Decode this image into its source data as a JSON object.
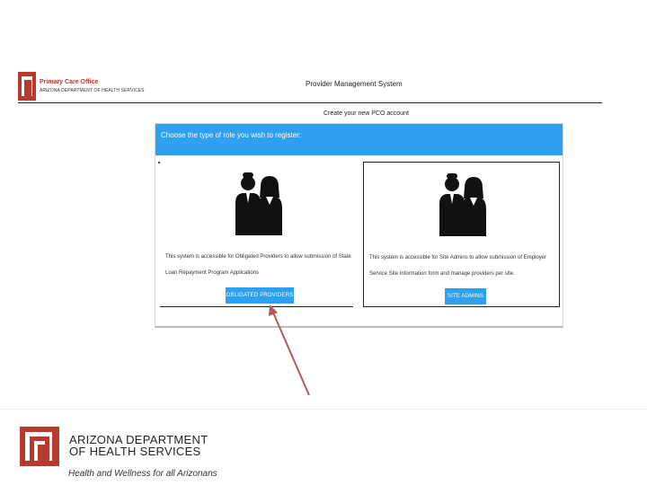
{
  "header": {
    "logo_line1": "Primary Care Office",
    "logo_line2": "ARIZONA DEPARTMENT OF HEALTH SERVICES",
    "app_title": "Provider Management System"
  },
  "page": {
    "subtitle": "Create your new PCO account"
  },
  "panel": {
    "header_text": "Choose the type of role you wish to register:"
  },
  "cards": [
    {
      "description_line1": "This system is accessible for Obligated Providers to allow submission of State",
      "description_line2": "Loan Repayment Program Applications",
      "button_label": "OBLIGATED PROVIDERS"
    },
    {
      "description_line1": "This system is accessible for Site Admins to allow submission of Employer",
      "description_line2": "Service Site Information form and manage providers per site.",
      "button_label": "SITE ADMINS"
    }
  ],
  "footer": {
    "name_line1": "ARIZONA DEPARTMENT",
    "name_line2": "OF HEALTH SERVICES",
    "tagline": "Health and Wellness for all Arizonans"
  },
  "colors": {
    "accent": "#2f9ff0",
    "brand_red": "#b83a2e",
    "arrow": "#b05a5a"
  }
}
